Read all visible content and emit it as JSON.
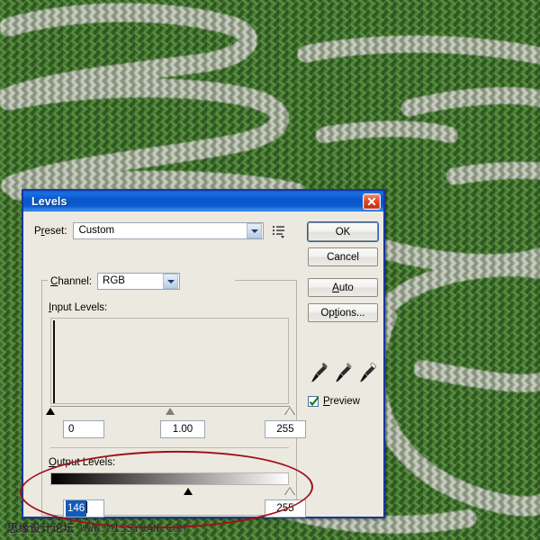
{
  "background": {
    "description": "green embroidered knit fabric with light stitched lettering",
    "base_color": "#3f6b2d",
    "stitch_light": "#b9c2b0",
    "stitch_dark": "#2e5220"
  },
  "dialog": {
    "title": "Levels",
    "close_icon": "close-icon",
    "preset": {
      "label": "Preset:",
      "value": "Custom",
      "menu_icon": "preset-options-icon",
      "dropdown_icon": "chevron-down-icon"
    },
    "channel": {
      "label": "Channel:",
      "value": "RGB",
      "dropdown_icon": "chevron-down-icon"
    },
    "input_levels": {
      "label": "Input Levels:",
      "black": "0",
      "gamma": "1.00",
      "white": "255",
      "black_pos_pct": 0,
      "gamma_pos_pct": 50,
      "white_pos_pct": 100
    },
    "output_levels": {
      "label": "Output Levels:",
      "black": "146",
      "white": "255",
      "black_selected": true,
      "black_pos_pct": 57.3,
      "white_pos_pct": 100
    },
    "buttons": {
      "ok": "OK",
      "cancel": "Cancel",
      "auto": "Auto",
      "options": "Options..."
    },
    "eyedroppers": [
      "eyedropper-black-point-icon",
      "eyedropper-gray-point-icon",
      "eyedropper-white-point-icon"
    ],
    "preview": {
      "label": "Preview",
      "checked": true,
      "check_icon": "check-icon"
    }
  },
  "annotation": {
    "shape": "ellipse",
    "color": "#9e1118",
    "target": "Output Levels section"
  },
  "watermark": {
    "site_cn": "思缘设计论坛",
    "site_url": "WWW.MISSYUAN.COM"
  }
}
